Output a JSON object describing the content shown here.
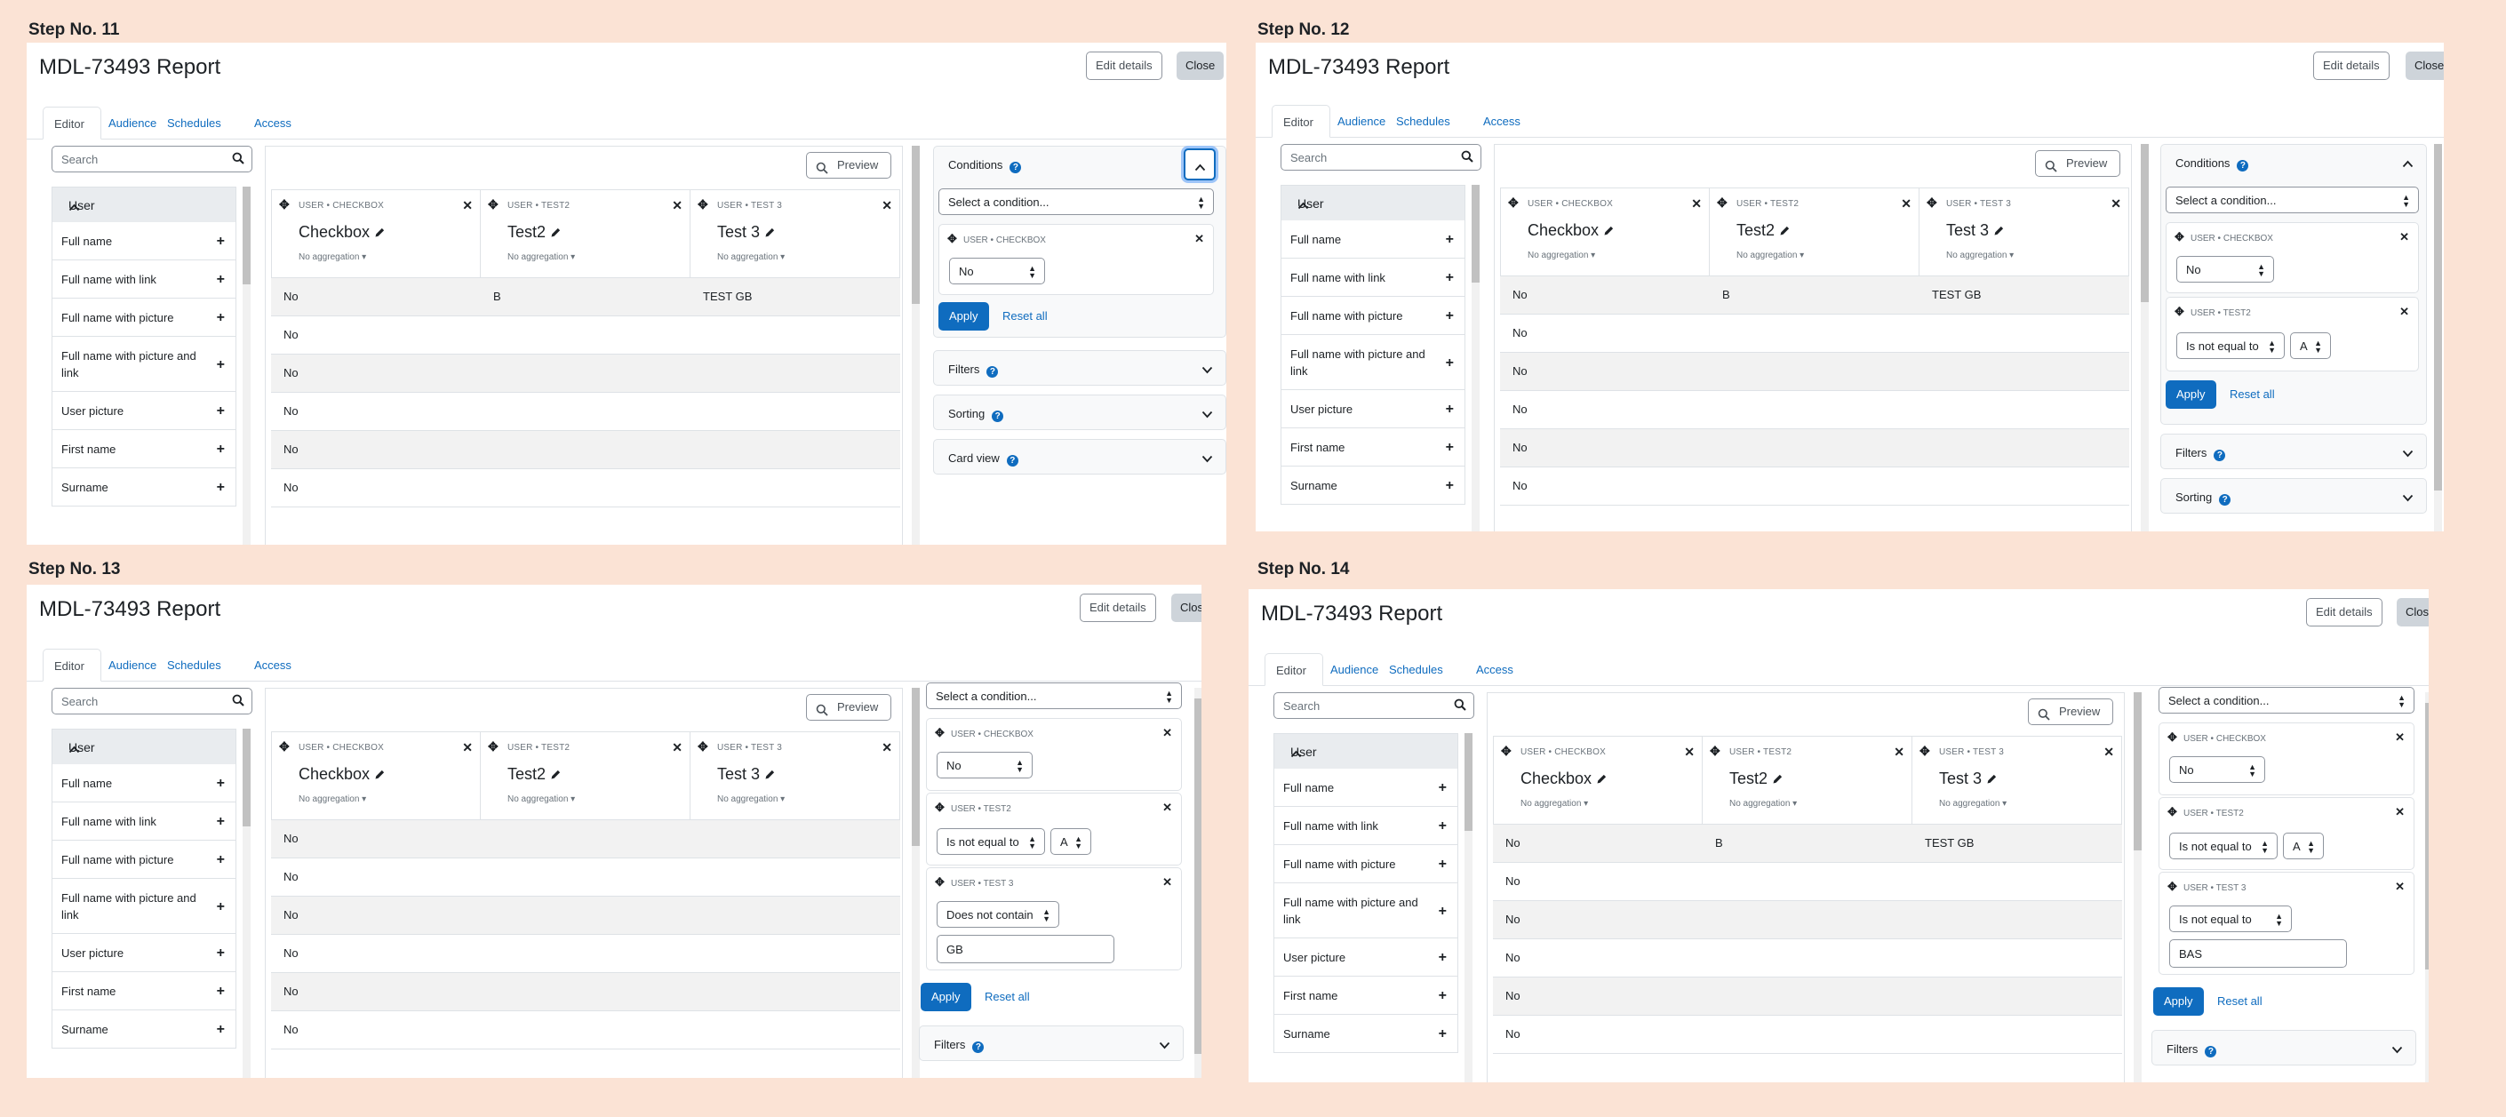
{
  "steps": [
    {
      "label": "Step No. 11"
    },
    {
      "label": "Step No. 12"
    },
    {
      "label": "Step No. 13"
    },
    {
      "label": "Step No. 14"
    }
  ],
  "header": {
    "title": "MDL-73493 Report",
    "edit_label": "Edit details",
    "close_label": "Close"
  },
  "tabs": [
    "Editor",
    "Audience",
    "Schedules",
    "Access"
  ],
  "sidebar": {
    "search_placeholder": "Search",
    "group": "User",
    "items": [
      "Full name",
      "Full name with link",
      "Full name with picture",
      "Full name with picture and link",
      "User picture",
      "First name",
      "Surname"
    ]
  },
  "preview_label": "Preview",
  "columns": [
    {
      "source": "USER • CHECKBOX",
      "name": "Checkbox",
      "agg": "No aggregation"
    },
    {
      "source": "USER • TEST2",
      "name": "Test2",
      "agg": "No aggregation"
    },
    {
      "source": "USER • TEST 3",
      "name": "Test 3",
      "agg": "No aggregation"
    }
  ],
  "table_rows": [
    [
      "No",
      "B",
      "TEST GB"
    ],
    [
      "No",
      "",
      ""
    ],
    [
      "No",
      "",
      ""
    ],
    [
      "No",
      "",
      ""
    ],
    [
      "No",
      "",
      ""
    ],
    [
      "No",
      "",
      ""
    ]
  ],
  "table_rows_step13": [
    [
      "No"
    ],
    [
      "No"
    ],
    [
      "No"
    ],
    [
      "No"
    ],
    [
      "No"
    ],
    [
      "No"
    ]
  ],
  "cards": {
    "conditions": "Conditions",
    "filters": "Filters",
    "sorting": "Sorting",
    "card_view": "Card view"
  },
  "condition": {
    "select_placeholder": "Select a condition...",
    "checkbox_source": "USER • CHECKBOX",
    "checkbox_value": "No",
    "test2_source": "USER • TEST2",
    "test2_operator": "Is not equal to",
    "test2_value": "A",
    "test3_source": "USER • TEST 3",
    "test3_operator_s13": "Does not contain",
    "test3_value_s13": "GB",
    "test3_operator_s14": "Is not equal to",
    "test3_value_s14": "BAS",
    "apply": "Apply",
    "reset": "Reset all"
  },
  "colors": {
    "accent": "#0f6cbf",
    "background": "#fbe3d5",
    "stripe": "#f2f2f2"
  }
}
